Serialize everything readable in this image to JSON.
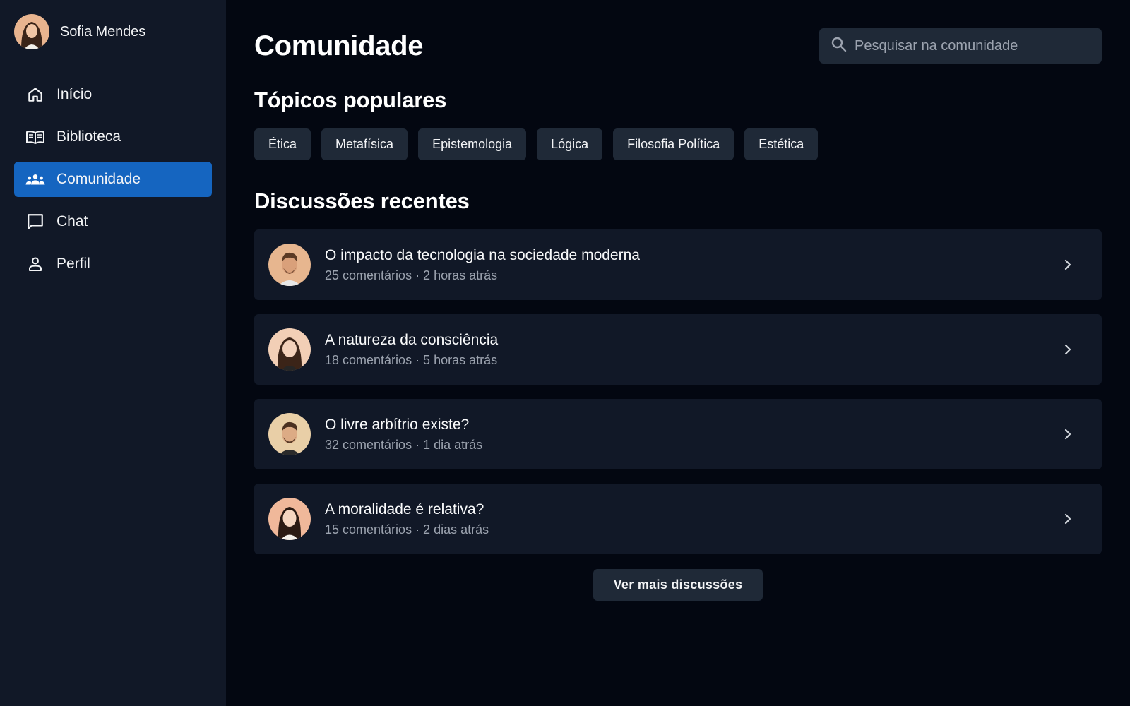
{
  "user": {
    "name": "Sofia Mendes"
  },
  "sidebar": {
    "items": [
      {
        "label": "Início",
        "icon": "home-icon"
      },
      {
        "label": "Biblioteca",
        "icon": "book-icon"
      },
      {
        "label": "Comunidade",
        "icon": "group-icon",
        "active": true
      },
      {
        "label": "Chat",
        "icon": "chat-icon"
      },
      {
        "label": "Perfil",
        "icon": "person-icon"
      }
    ]
  },
  "header": {
    "title": "Comunidade"
  },
  "search": {
    "placeholder": "Pesquisar na comunidade",
    "icon": "search-icon"
  },
  "topics": {
    "title": "Tópicos populares",
    "items": [
      "Ética",
      "Metafísica",
      "Epistemologia",
      "Lógica",
      "Filosofia Política",
      "Estética"
    ]
  },
  "discussions": {
    "title": "Discussões recentes",
    "items": [
      {
        "title": "O impacto da tecnologia na sociedade moderna",
        "meta": "25 comentários · 2 horas atrás"
      },
      {
        "title": "A natureza da consciência",
        "meta": "18 comentários · 5 horas atrás"
      },
      {
        "title": "O livre arbítrio existe?",
        "meta": "32 comentários · 1 dia atrás"
      },
      {
        "title": "A moralidade é relativa?",
        "meta": "15 comentários · 2 dias atrás"
      }
    ]
  },
  "more_button": {
    "label": "Ver mais discussões"
  },
  "colors": {
    "background": "#030711",
    "sidebar": "#111827",
    "accent": "#1565c0",
    "card": "#111827",
    "chip": "#1f2937"
  }
}
